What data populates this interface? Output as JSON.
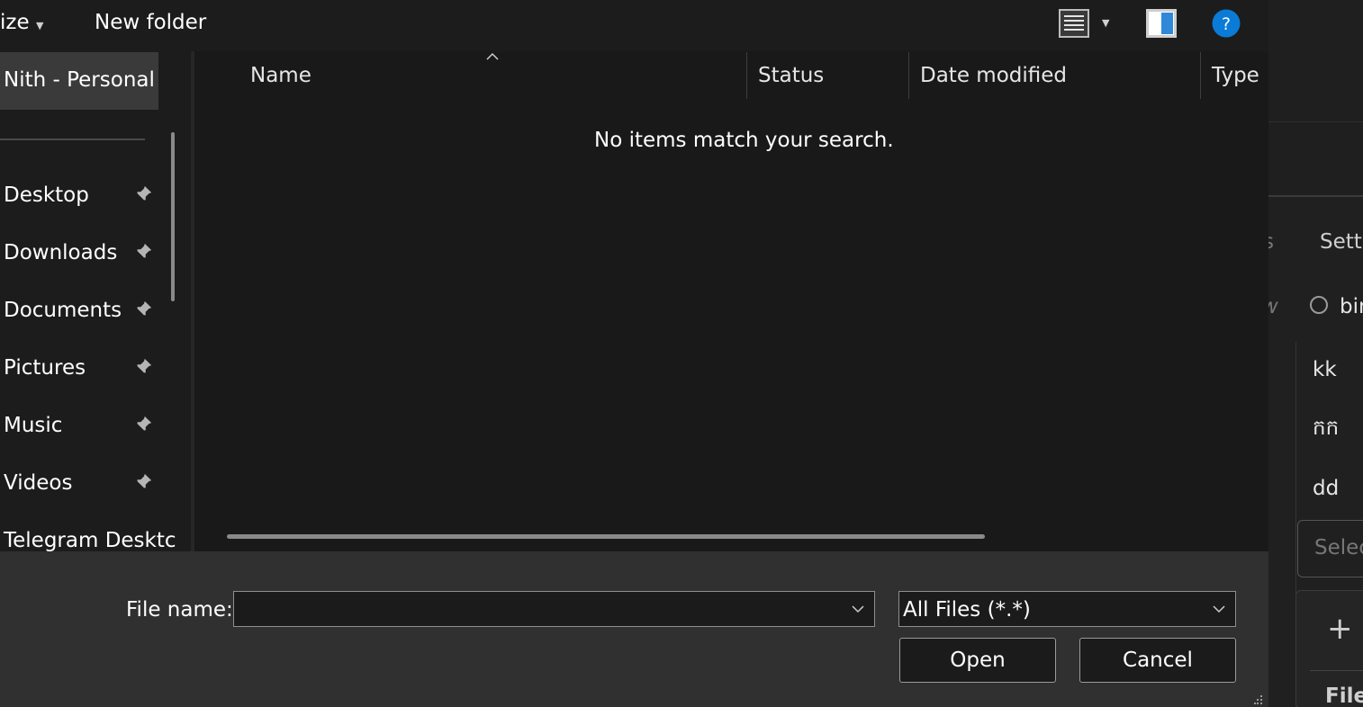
{
  "toolbar": {
    "organize_label": "ize",
    "new_folder_label": "New folder",
    "icons": [
      "view-details-icon",
      "view-options-caret-icon",
      "preview-pane-icon",
      "help-icon"
    ],
    "help_color": "#0a7bd6"
  },
  "nav": {
    "selected": "Nith - Personal",
    "items": [
      {
        "label": "Desktop",
        "icon": "pin-icon"
      },
      {
        "label": "Downloads",
        "icon": "pin-icon"
      },
      {
        "label": "Documents",
        "icon": "pin-icon"
      },
      {
        "label": "Pictures",
        "icon": "pin-icon"
      },
      {
        "label": "Music",
        "icon": "pin-icon"
      },
      {
        "label": "Videos",
        "icon": "pin-icon"
      },
      {
        "label": "Telegram Desktc"
      }
    ]
  },
  "list": {
    "columns": [
      "Name",
      "Status",
      "Date modified",
      "Type"
    ],
    "empty_message": "No items match your search."
  },
  "footer": {
    "file_name_label": "File name:",
    "file_name_value": "",
    "file_type": "All Files (*.*)",
    "open_label": "Open",
    "cancel_label": "Cancel"
  },
  "background_app": {
    "tab_partial": "s",
    "settings_partial": "Sett",
    "w_partial": "w",
    "radio_label": "bin",
    "rows": [
      "kk",
      "កក",
      "dd"
    ],
    "select_placeholder": "Selec",
    "add_symbol": "+",
    "file_partial": "File"
  }
}
